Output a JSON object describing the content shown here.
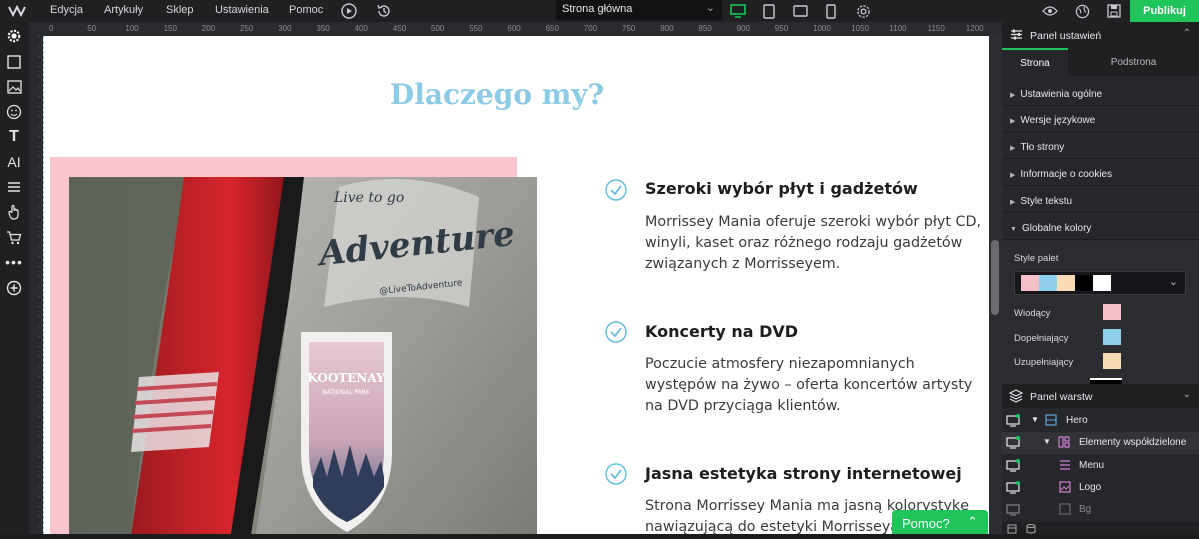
{
  "topbar": {
    "menu": [
      "Edycja",
      "Artykuły",
      "Sklep",
      "Ustawienia",
      "Pomoc"
    ],
    "page_select": "Strona główna",
    "publish": "Publikuj"
  },
  "ruler": {
    "ticks": [
      "0",
      "50",
      "100",
      "150",
      "200",
      "250",
      "300",
      "350",
      "400",
      "450",
      "500",
      "550",
      "600",
      "650",
      "700",
      "750",
      "800",
      "850",
      "900",
      "950",
      "1000",
      "1050",
      "1100",
      "1150",
      "1200"
    ]
  },
  "canvas": {
    "heading": "Dlaczego my?",
    "features": [
      {
        "title": "Szeroki wybór płyt i gadżetów",
        "text": [
          "Morrissey Mania oferuje szeroki wybór płyt CD,",
          "winyli, kaset oraz różnego rodzaju gadżetów",
          "związanych z Morrisseyem."
        ]
      },
      {
        "title": "Koncerty na DVD",
        "text": [
          "Poczucie atmosfery niezapomnianych",
          "występów na żywo – oferta koncertów artysty",
          "na DVD przyciąga klientów."
        ]
      },
      {
        "title": "Jasna estetyka strony internetowej",
        "text": [
          "Strona Morrissey Mania ma jasną kolorystykę",
          "nawiązującą do estetyki Morrisseya"
        ]
      }
    ],
    "photo_sticker_top": "Adventure",
    "photo_sticker_script": "Live to go",
    "photo_sticker_handle": "@LiveToAdventure",
    "photo_badge_title": "KOOTENAY",
    "photo_badge_subtitle": "NATIONAL PARK",
    "help_button": "Pomoc?"
  },
  "settings_panel": {
    "title": "Panel ustawień",
    "tabs": [
      "Strona",
      "Podstrona"
    ],
    "sections": [
      "Ustawienia ogólne",
      "Wersje językowe",
      "Tło strony",
      "Informacje o cookies",
      "Style tekstu",
      "Globalne kolory"
    ],
    "palette_label": "Style palet",
    "palette_colors": [
      "#f7c0c9",
      "#8fcfea",
      "#fad9b5",
      "#000000",
      "#ffffff"
    ],
    "color_rows": [
      {
        "label": "Wiodący",
        "color": "#f7c0c9"
      },
      {
        "label": "Dopełniający",
        "color": "#8fcfea"
      },
      {
        "label": "Uzupełniający",
        "color": "#fad9b5"
      }
    ]
  },
  "layers_panel": {
    "title": "Panel warstw",
    "layers": [
      {
        "name": "Hero",
        "icon": "section-icon"
      },
      {
        "name": "Elementy współdzielone",
        "icon": "shared-elements-icon"
      },
      {
        "name": "Menu",
        "icon": "menu-icon"
      },
      {
        "name": "Logo",
        "icon": "image-icon"
      },
      {
        "name": "Bg",
        "icon": "bg-icon"
      }
    ]
  },
  "colors": {
    "accent_green": "#1fc45a",
    "heading_blue": "#8ccbe6",
    "check_blue": "#67bde0",
    "pink_block": "#f9c6cd"
  }
}
